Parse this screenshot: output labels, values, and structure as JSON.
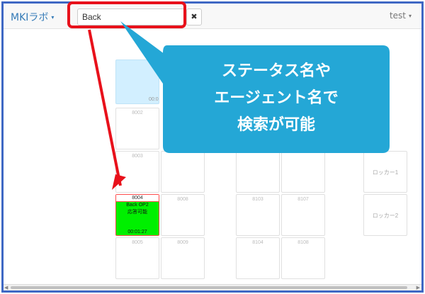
{
  "navbar": {
    "brand": "MKIラボ",
    "brand_caret": "▾",
    "user": "test",
    "user_caret": "▾"
  },
  "search": {
    "value": "Back",
    "clear_icon": "✖"
  },
  "seats": {
    "blue_time": "00:0",
    "s8002": "8002",
    "s8003": "8003",
    "s8004": "8004",
    "s8004_line1": "Back OP2",
    "s8004_line2": "応答可能",
    "s8004_time": "00:01:27",
    "s8005": "8005",
    "s8008": "8008",
    "s8009": "8009",
    "s8103": "8103",
    "s8104": "8104",
    "s8107": "8107",
    "s8108": "8108",
    "locker1": "ロッカー1",
    "locker2": "ロッカー2"
  },
  "callout": {
    "line1": "ステータス名や",
    "line2": "エージェント名で",
    "line3": "検索が可能"
  },
  "colors": {
    "frame": "#3f68c4",
    "highlight": "#e8111b",
    "callout": "#24a7d6",
    "available": "#00f000",
    "selected_cell": "#d2efff"
  }
}
